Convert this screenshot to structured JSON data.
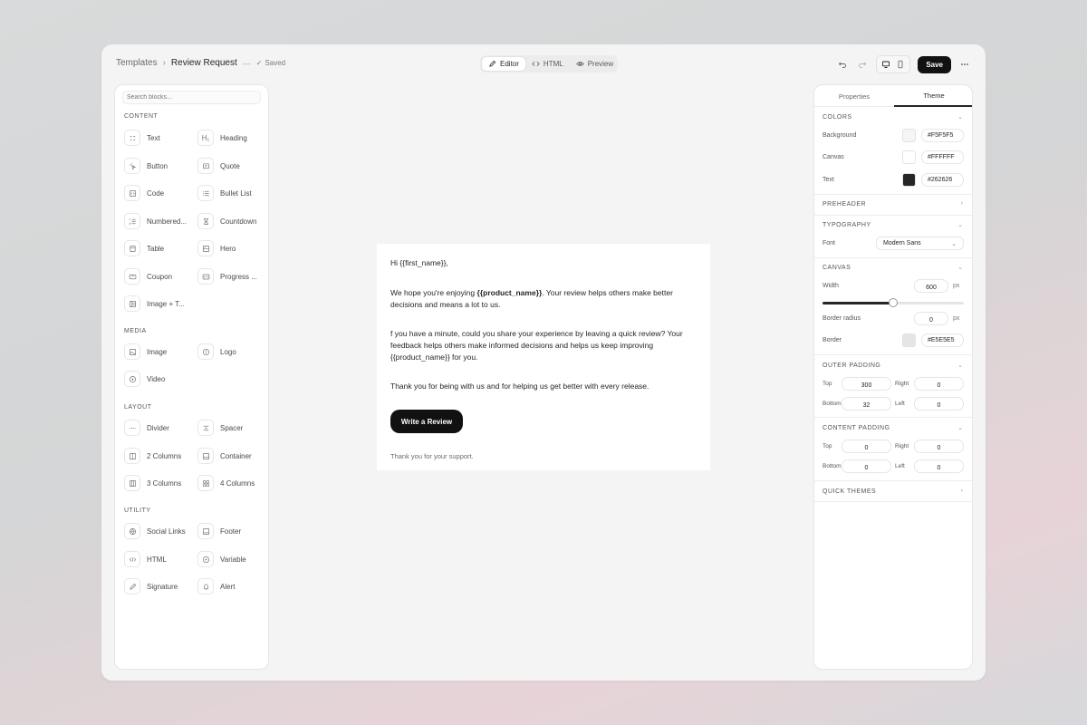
{
  "breadcrumb": {
    "parent": "Templates",
    "current": "Review Request",
    "status": "Saved"
  },
  "modes": [
    {
      "label": "Editor",
      "icon": "pen-icon",
      "active": true
    },
    {
      "label": "HTML",
      "icon": "code-icon",
      "active": false
    },
    {
      "label": "Preview",
      "icon": "eye-icon",
      "active": false
    }
  ],
  "toolbar": {
    "save_label": "Save"
  },
  "left_panel": {
    "search_placeholder": "Search blocks...",
    "sections": {
      "content": "CONTENT",
      "media": "MEDIA",
      "layout": "LAYOUT",
      "utility": "UTILITY"
    },
    "content_blocks": [
      "Text",
      "Heading",
      "Button",
      "Quote",
      "Code",
      "Bullet List",
      "Numbered...",
      "Countdown",
      "Table",
      "Hero",
      "Coupon",
      "Progress ...",
      "Image + T..."
    ],
    "media_blocks": [
      "Image",
      "Logo",
      "Video"
    ],
    "layout_blocks": [
      "Divider",
      "Spacer",
      "2 Columns",
      "Container",
      "3 Columns",
      "4 Columns"
    ],
    "utility_blocks": [
      "Social Links",
      "Footer",
      "HTML",
      "Variable",
      "Signature",
      "Alert"
    ]
  },
  "email": {
    "greeting": "Hi {{first_name}},",
    "p1_before": "We hope you're enjoying ",
    "p1_bold": "{{product_name}}",
    "p1_after": ". Your review helps others make better decisions and means a lot to us.",
    "p2": "f you have a minute, could you share your experience by leaving a quick review? Your feedback helps others make informed decisions and helps us keep improving {{product_name}} for you.",
    "p3": "Thank you for being with us and for helping us get better with every release.",
    "cta": "Write a Review",
    "footnote": "Thank you for your support."
  },
  "right_panel": {
    "tabs": [
      "Properties",
      "Theme"
    ],
    "colors": {
      "title": "COLORS",
      "background_label": "Background",
      "background_value": "#F5F5F5",
      "canvas_label": "Canvas",
      "canvas_value": "#FFFFFF",
      "text_label": "Text",
      "text_value": "#262626"
    },
    "preheader": "PREHEADER",
    "typography": {
      "title": "TYPOGRAPHY",
      "font_label": "Font",
      "font_value": "Modern Sans"
    },
    "canvas": {
      "title": "CANVAS",
      "width_label": "Width",
      "width_value": "600",
      "width_unit": "px",
      "radius_label": "Border radius",
      "radius_value": "0",
      "radius_unit": "px",
      "border_label": "Border",
      "border_value": "#E5E5E5",
      "width_slider_fraction": 0.5
    },
    "outer_padding": {
      "title": "OUTER PADDING",
      "top_label": "Top",
      "top": "300",
      "right_label": "Right",
      "right": "0",
      "bottom_label": "Bottom",
      "bottom": "32",
      "left_label": "Left",
      "left": "0"
    },
    "content_padding": {
      "title": "CONTENT PADDING",
      "top_label": "Top",
      "top": "0",
      "right_label": "Right",
      "right": "0",
      "bottom_label": "Bottom",
      "bottom": "0",
      "left_label": "Left",
      "left": "0"
    },
    "quick_themes": "QUICK THEMES"
  }
}
